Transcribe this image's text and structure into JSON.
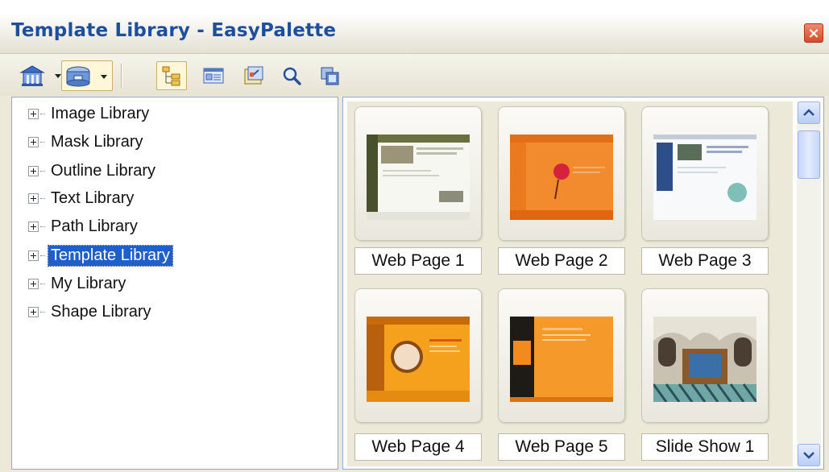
{
  "window": {
    "title": "Template Library - EasyPalette",
    "close_glyph": "×"
  },
  "toolbar": {
    "buttons": [
      {
        "icon": "library-home-icon",
        "dropdown": true
      },
      {
        "icon": "library-box-icon",
        "dropdown": true
      },
      {
        "icon": "tree-view-icon",
        "pressed": true
      },
      {
        "icon": "details-view-icon"
      },
      {
        "icon": "properties-icon"
      },
      {
        "icon": "search-icon"
      },
      {
        "icon": "copy-icon"
      }
    ]
  },
  "tree": {
    "items": [
      {
        "label": "Image Library"
      },
      {
        "label": "Mask Library"
      },
      {
        "label": "Outline Library"
      },
      {
        "label": "Text Library"
      },
      {
        "label": "Path Library"
      },
      {
        "label": "Template Library",
        "selected": true
      },
      {
        "label": "My Library"
      },
      {
        "label": "Shape Library"
      }
    ]
  },
  "gallery": {
    "items": [
      {
        "caption": "Web Page 1"
      },
      {
        "caption": "Web Page 2"
      },
      {
        "caption": "Web Page 3"
      },
      {
        "caption": "Web Page 4"
      },
      {
        "caption": "Web Page 5"
      },
      {
        "caption": "Slide Show 1"
      }
    ]
  },
  "colors": {
    "selection": "#1f5fc9",
    "title_text": "#1d4f9c",
    "close_button": "#d9482b"
  }
}
